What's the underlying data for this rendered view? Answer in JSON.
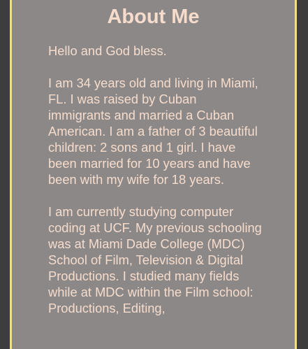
{
  "page": {
    "title": "About Me",
    "paragraphs": [
      "Hello and God bless.",
      "I am 34 years old and living in Miami, FL. I was raised by Cuban immigrants and married a Cuban American. I am a father of 3 beautiful children: 2 sons and 1 girl. I have been married for 10 years and have been with my wife for 18 years.",
      "I am currently studying computer coding at UCF. My previous schooling was at Miami Dade College (MDC) School of Film, Television & Digital Productions. I studied many fields while at MDC within the Film school: Productions, Editing,"
    ]
  },
  "colors": {
    "page_background": "#3d3d3d",
    "panel_background": "#8c8887",
    "panel_border": "#f3dc8c",
    "text": "#f6dccc"
  }
}
